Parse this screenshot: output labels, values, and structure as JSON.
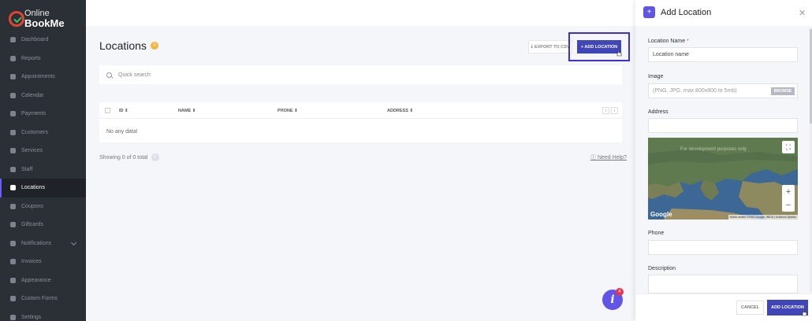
{
  "logo": {
    "line1": "Online",
    "line2": "BookMe"
  },
  "sidebar": {
    "items": [
      {
        "label": "Dashboard",
        "icon": "dashboard-icon"
      },
      {
        "label": "Reports",
        "icon": "chart-icon"
      },
      {
        "label": "Appointments",
        "icon": "clock-icon"
      },
      {
        "label": "Calendar",
        "icon": "calendar-icon"
      },
      {
        "label": "Payments",
        "icon": "card-icon"
      },
      {
        "label": "Customers",
        "icon": "users-icon"
      },
      {
        "label": "Services",
        "icon": "list-icon"
      },
      {
        "label": "Staff",
        "icon": "user-icon"
      },
      {
        "label": "Locations",
        "icon": "location-arrow-icon",
        "active": true
      },
      {
        "label": "Coupons",
        "icon": "tag-icon"
      },
      {
        "label": "Giftcards",
        "icon": "gift-icon"
      },
      {
        "label": "Notifications",
        "icon": "bell-icon"
      },
      {
        "label": "Invoices",
        "icon": "file-icon"
      },
      {
        "label": "Appearance",
        "icon": "brush-icon"
      },
      {
        "label": "Custom Forms",
        "icon": "pen-icon"
      },
      {
        "label": "Settings",
        "icon": "gear-icon"
      }
    ]
  },
  "main": {
    "title": "Locations",
    "count": "0",
    "export_label": "EXPORT TO CSV",
    "add_label": "+ ADD LOCATION",
    "search_placeholder": "Quick search",
    "columns": [
      "ID",
      "NAME",
      "PHONE",
      "ADDRESS"
    ],
    "empty_text": "No any data!",
    "showing": "Showing 0 of 0 total",
    "showing_badge": "0",
    "help": "Need Help?",
    "fab_badge": "4",
    "fab_letter": "i"
  },
  "panel": {
    "title": "Add Location",
    "name_label": "Location Name",
    "name_required": "*",
    "name_value": "Location name",
    "image_label": "Image",
    "image_placeholder": "(PNG, JPG, max 800x800 to 5mb)",
    "browse_label": "BROWSE",
    "address_label": "Address",
    "map_dev_text": "For development purposes only",
    "map_attrib": "Harita verileri ©2021 Google, INEGI | Kullanım Şartları",
    "google_text": "Google",
    "phone_label": "Phone",
    "description_label": "Description",
    "cancel_label": "CANCEL",
    "submit_label": "ADD LOCATION"
  },
  "colors": {
    "accent": "#4046b8",
    "highlight": "#3b2fd9",
    "sidebar_bg": "#2b2f36",
    "badge": "#f3b43a"
  }
}
